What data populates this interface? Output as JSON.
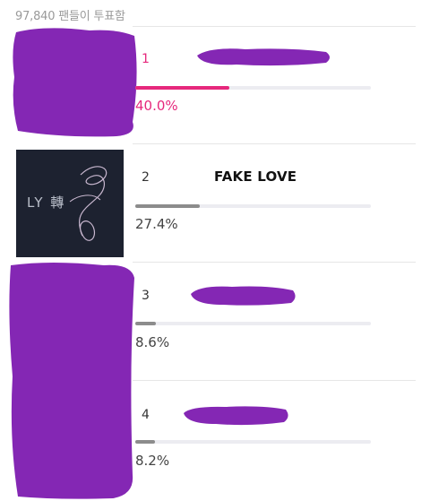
{
  "header": {
    "vote_count_text": "97,840 팬들이 투표함"
  },
  "colors": {
    "accent": "#e6287c",
    "bar_default": "#8c8c8c",
    "track": "#ececf1",
    "redaction": "#8427b4",
    "album_bg": "#1d2230"
  },
  "rows": [
    {
      "rank": "1",
      "title": "",
      "percent_text": "40.0%",
      "percent": 40.0,
      "title_redacted": true,
      "cover_redacted": true
    },
    {
      "rank": "2",
      "title": "FAKE LOVE",
      "percent_text": "27.4%",
      "percent": 27.4,
      "title_redacted": false,
      "cover_redacted": false,
      "cover_text": "LY 轉"
    },
    {
      "rank": "3",
      "title": "",
      "percent_text": "8.6%",
      "percent": 8.6,
      "title_redacted": true,
      "cover_redacted": true
    },
    {
      "rank": "4",
      "title": "",
      "percent_text": "8.2%",
      "percent": 8.2,
      "title_redacted": true,
      "cover_redacted": true
    }
  ]
}
